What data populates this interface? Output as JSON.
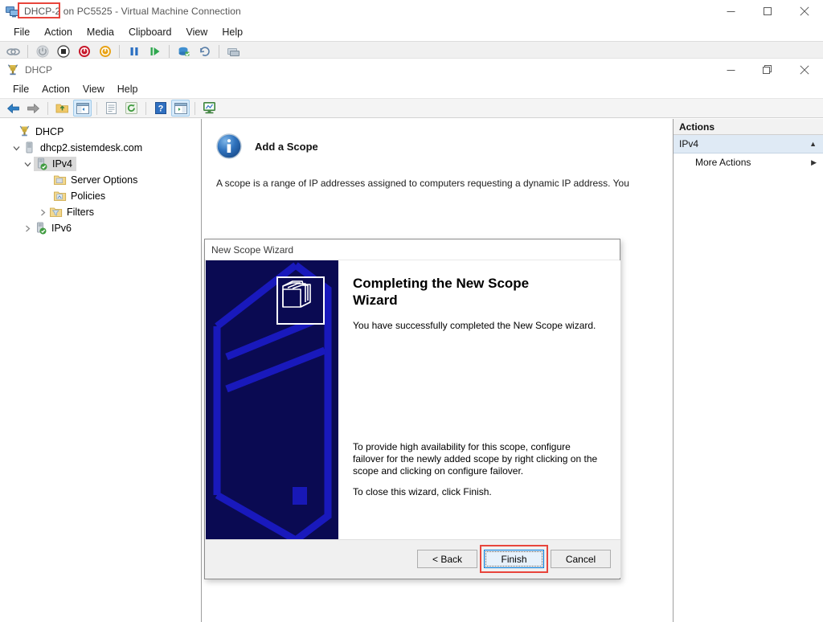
{
  "vm_window": {
    "title": "DHCP-2 on PC5525 - Virtual Machine Connection",
    "title_highlight": "DHCP-2",
    "title_rest": " on PC5525 - Virtual Machine Connection",
    "icon": "virtual-machine-icon",
    "menu": [
      "File",
      "Action",
      "Media",
      "Clipboard",
      "View",
      "Help"
    ],
    "caption": {
      "minimize": "—",
      "maximize": "□",
      "close": "✕"
    },
    "toolbar": [
      {
        "name": "ctrl-alt-del-icon"
      },
      {
        "name": "start-icon"
      },
      {
        "name": "shutdown-icon"
      },
      {
        "name": "turn-off-icon"
      },
      {
        "name": "power-icon"
      },
      {
        "name": "pause-icon"
      },
      {
        "name": "resume-icon"
      },
      {
        "name": "checkpoint-icon"
      },
      {
        "name": "revert-icon"
      },
      {
        "name": "enhanced-session-icon"
      }
    ]
  },
  "dhcp_window": {
    "title": "DHCP",
    "icon": "dhcp-icon",
    "menu": [
      "File",
      "Action",
      "View",
      "Help"
    ],
    "caption": {
      "minimize": "—",
      "restore": "restore-icon",
      "close": "✕"
    },
    "toolbar": [
      {
        "name": "back-arrow-icon"
      },
      {
        "name": "forward-arrow-icon"
      },
      {
        "name": "up-folder-icon"
      },
      {
        "name": "show-hide-console-tree-icon"
      },
      {
        "name": "properties-icon"
      },
      {
        "name": "refresh-icon"
      },
      {
        "name": "help-icon"
      },
      {
        "name": "show-hide-action-pane-icon"
      },
      {
        "name": "export-list-icon"
      }
    ]
  },
  "tree": [
    {
      "label": "DHCP",
      "indent": 0,
      "expander": "",
      "icon": "dhcp-root-icon",
      "selected": false
    },
    {
      "label": "dhcp2.sistemdesk.com",
      "indent": 1,
      "expander": "v",
      "icon": "server-icon",
      "selected": false
    },
    {
      "label": "IPv4",
      "indent": 2,
      "expander": "v",
      "icon": "ipv4-icon",
      "selected": true
    },
    {
      "label": "Server Options",
      "indent": 4,
      "expander": "",
      "icon": "server-options-icon",
      "selected": false
    },
    {
      "label": "Policies",
      "indent": 4,
      "expander": "",
      "icon": "policies-icon",
      "selected": false
    },
    {
      "label": "Filters",
      "indent": 3,
      "expander": ">",
      "icon": "filters-icon",
      "selected": false
    },
    {
      "label": "IPv6",
      "indent": 2,
      "expander": ">",
      "icon": "ipv6-icon",
      "selected": false
    }
  ],
  "main_pane": {
    "icon": "info-icon",
    "heading": "Add a Scope",
    "description": "A scope is a range of IP addresses assigned to computers requesting a dynamic IP address. You"
  },
  "actions_pane": {
    "header": "Actions",
    "group_label": "IPv4",
    "group_caret": "▲",
    "items": [
      {
        "label": "More Actions",
        "caret": "▶"
      }
    ]
  },
  "wizard": {
    "title": "New Scope Wizard",
    "banner_icon": "folders-icon",
    "heading": "Completing the New Scope Wizard",
    "paragraph1": "You have successfully completed the New Scope wizard.",
    "paragraph2": "To provide high availability for this scope, configure failover for the newly added scope by right clicking on the scope and clicking on configure failover.",
    "paragraph3": "To close this wizard, click Finish.",
    "buttons": {
      "back": "< Back",
      "finish": "Finish",
      "cancel": "Cancel"
    }
  },
  "annotations": {
    "accent_color": "#e8453c",
    "targets": [
      "vm-title-highlight",
      "finish-button-highlight"
    ]
  }
}
